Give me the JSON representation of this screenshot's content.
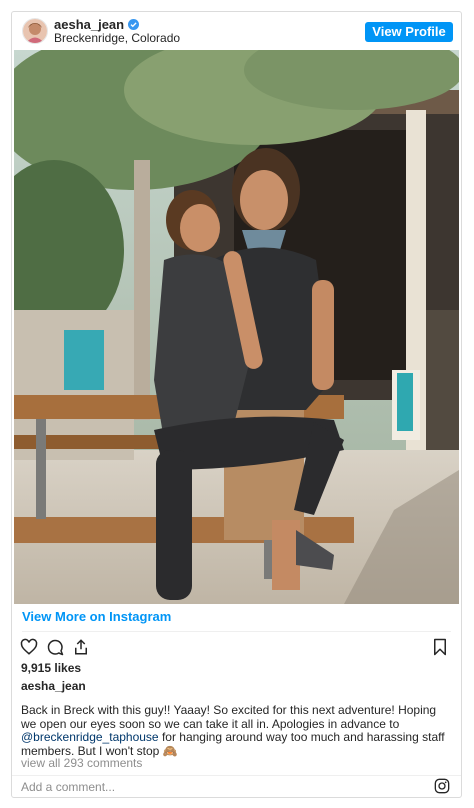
{
  "header": {
    "username": "aesha_jean",
    "location": "Breckenridge, Colorado",
    "view_profile_label": "View Profile"
  },
  "photo": {
    "icon": "photo-couple-outdoors"
  },
  "view_more_label": "View More on Instagram",
  "likes_text": "9,915 likes",
  "owner": "aesha_jean",
  "caption": {
    "part1": "Back in Breck with this guy!! Yaaay! So excited for this next adventure! Hoping we open our eyes soon so we can take it all in. Apologies in advance to ",
    "mention": "@breckenridge_taphouse",
    "part2": " for hanging around way too much and harassing staff members. But I won't stop ",
    "emoji": "🙈"
  },
  "comments_link": "view all 293 comments",
  "comment_placeholder": "Add a comment...",
  "colors": {
    "accent": "#0095f6",
    "mention": "#00376b",
    "muted": "#8e8e8e"
  }
}
